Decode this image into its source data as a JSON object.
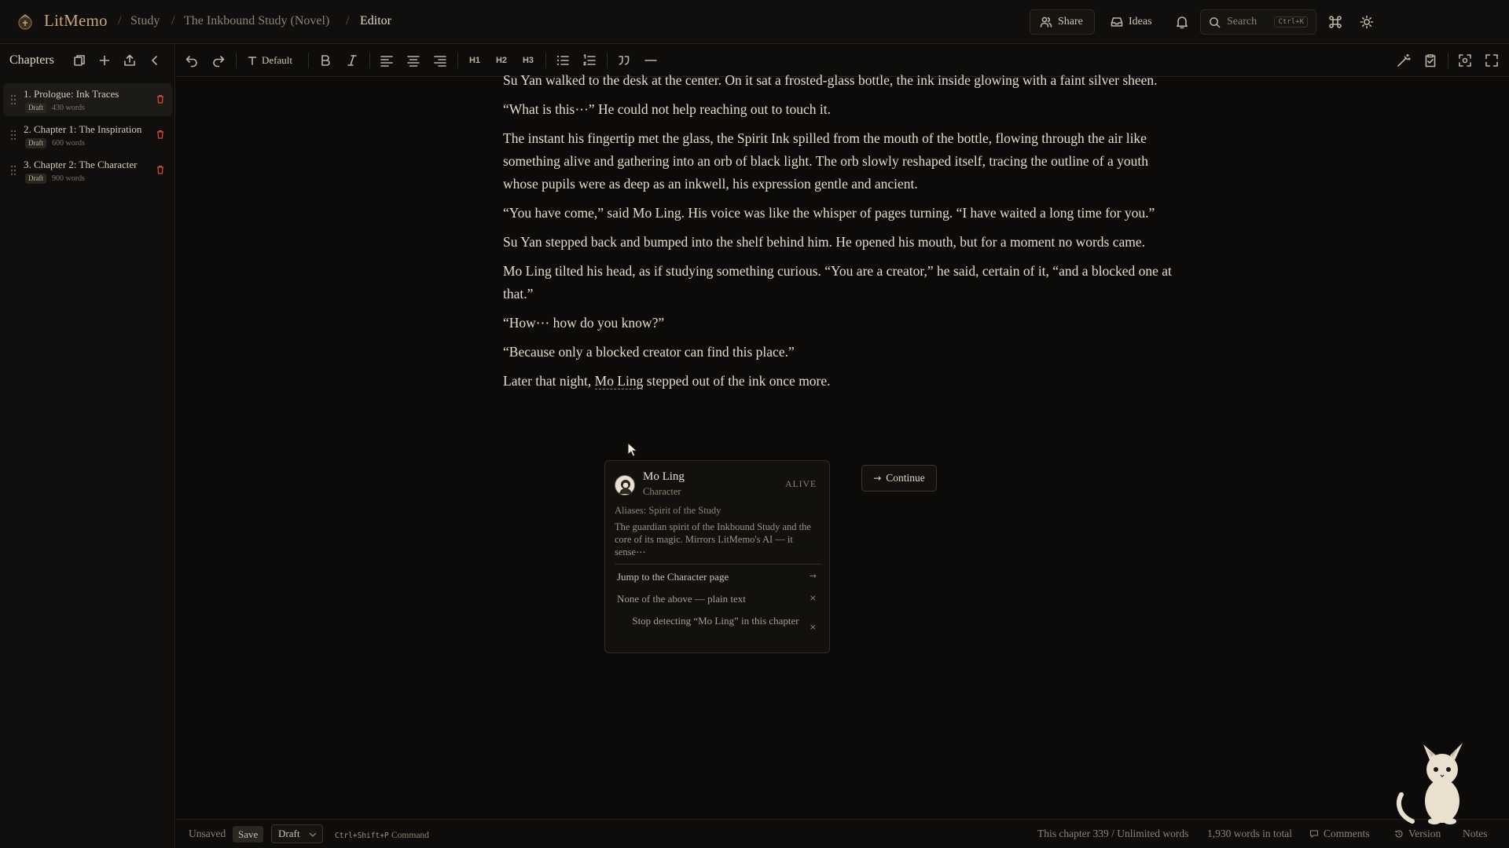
{
  "app": {
    "brand": "LitMemo",
    "breadcrumb": [
      "Study",
      "The Inkbound Study (Novel)",
      "Editor"
    ]
  },
  "topbar": {
    "share_label": "Share",
    "ideas_label": "Ideas",
    "search_placeholder": "Search",
    "search_shortcut": "Ctrl+K"
  },
  "sidebar": {
    "title": "Chapters",
    "chapters": [
      {
        "title": "1. Prologue: Ink Traces",
        "status": "Draft",
        "words": "430 words"
      },
      {
        "title": "2. Chapter 1: The Inspiration",
        "status": "Draft",
        "words": "600 words"
      },
      {
        "title": "3. Chapter 2: The Character",
        "status": "Draft",
        "words": "900 words"
      }
    ]
  },
  "toolbar": {
    "text_style": "Default",
    "h1": "H1",
    "h2": "H2",
    "h3": "H3"
  },
  "document": {
    "paragraphs": [
      "Su Yan walked to the desk at the center. On it sat a frosted-glass bottle, the ink inside glowing with a faint silver sheen.",
      "“What is this⋯”  He could not help reaching out to touch it.",
      "The instant his fingertip met the glass, the Spirit Ink spilled from the mouth of the bottle, flowing through the air like something alive and gathering into an orb of black light. The orb slowly reshaped itself, tracing the outline of a youth whose pupils were as deep as an inkwell, his expression gentle and ancient.",
      "“You have come,”  said Mo Ling. His voice was like the whisper of pages turning.  “I have waited a long time for you.”",
      "Su Yan stepped back and bumped into the shelf behind him. He opened his mouth, but for a moment no words came.",
      "Mo Ling tilted his head, as if studying something curious.  “You are a creator,”  he said, certain of it,  “and a blocked one at that.”",
      "“How⋯ how do you know?”",
      "“Because only a blocked creator can find this place.”"
    ],
    "last_before": "Later that night, ",
    "last_mention": "Mo Ling",
    "last_after": " stepped out of the ink once more."
  },
  "popover": {
    "name": "Mo Ling",
    "type": "Character",
    "status": "ALIVE",
    "aliases": "Aliases: Spirit of the Study",
    "description": "The guardian spirit of the Inkbound Study and the core of its magic. Mirrors LitMemo's AI — it sense⋯",
    "actions": {
      "jump": "Jump to the Character page",
      "plain": "None of the above — plain text",
      "stop": "Stop detecting “Mo Ling” in this chapter"
    }
  },
  "continue_label": "Continue",
  "statusbar": {
    "save_state": "Unsaved",
    "save_label": "Save",
    "status_value": "Draft",
    "command_shortcut": "Ctrl+Shift+P",
    "command_label": "Command",
    "chapter_count": "This chapter 339 / Unlimited words",
    "total_count": "1,930 words in total",
    "comments_label": "Comments",
    "version_label": "Version",
    "notes_label": "Notes"
  },
  "colors": {
    "accent": "#caa575",
    "background": "#0c0b09",
    "delete": "#d04a3c"
  }
}
